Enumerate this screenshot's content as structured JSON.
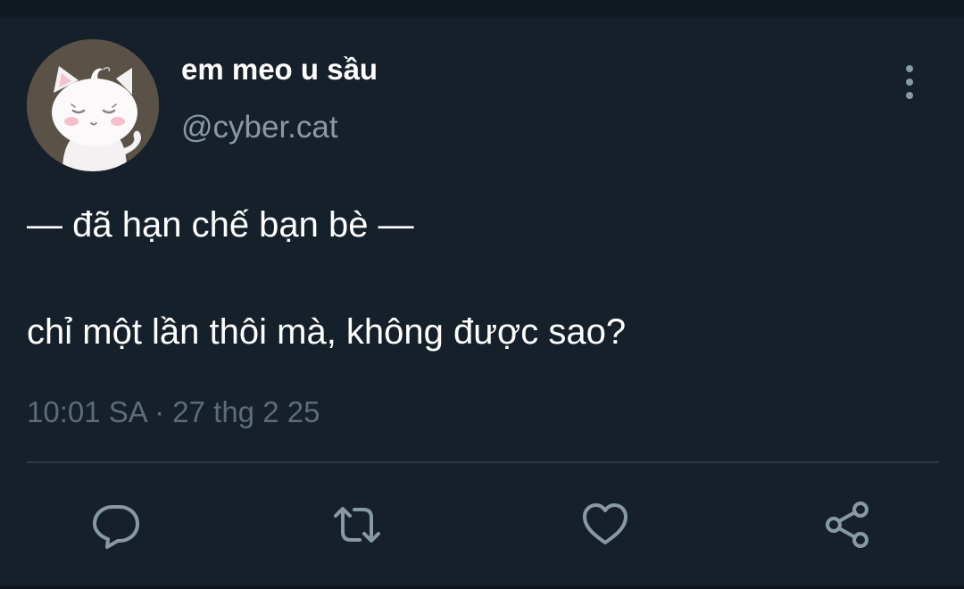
{
  "tweet": {
    "display_name": "em meo u sầu",
    "handle": "@cyber.cat",
    "text_line_1": "— đã hạn chế bạn bè —",
    "text_line_2": "chỉ một lần thôi mà, không được sao?",
    "timestamp": "10:01 SA · 27 thg 2 25"
  },
  "actions": {
    "reply_icon": "speech-bubble-icon",
    "retweet_icon": "retweet-arrows-icon",
    "like_icon": "heart-outline-icon",
    "share_icon": "share-nodes-icon",
    "more_icon": "vertical-dots-icon"
  },
  "colors": {
    "background": "#15202b",
    "primary_text": "#ffffff",
    "secondary_text": "#8899a6",
    "timestamp_text": "#5b6c7a",
    "divider": "#2c3945",
    "icon": "#8899a6"
  }
}
